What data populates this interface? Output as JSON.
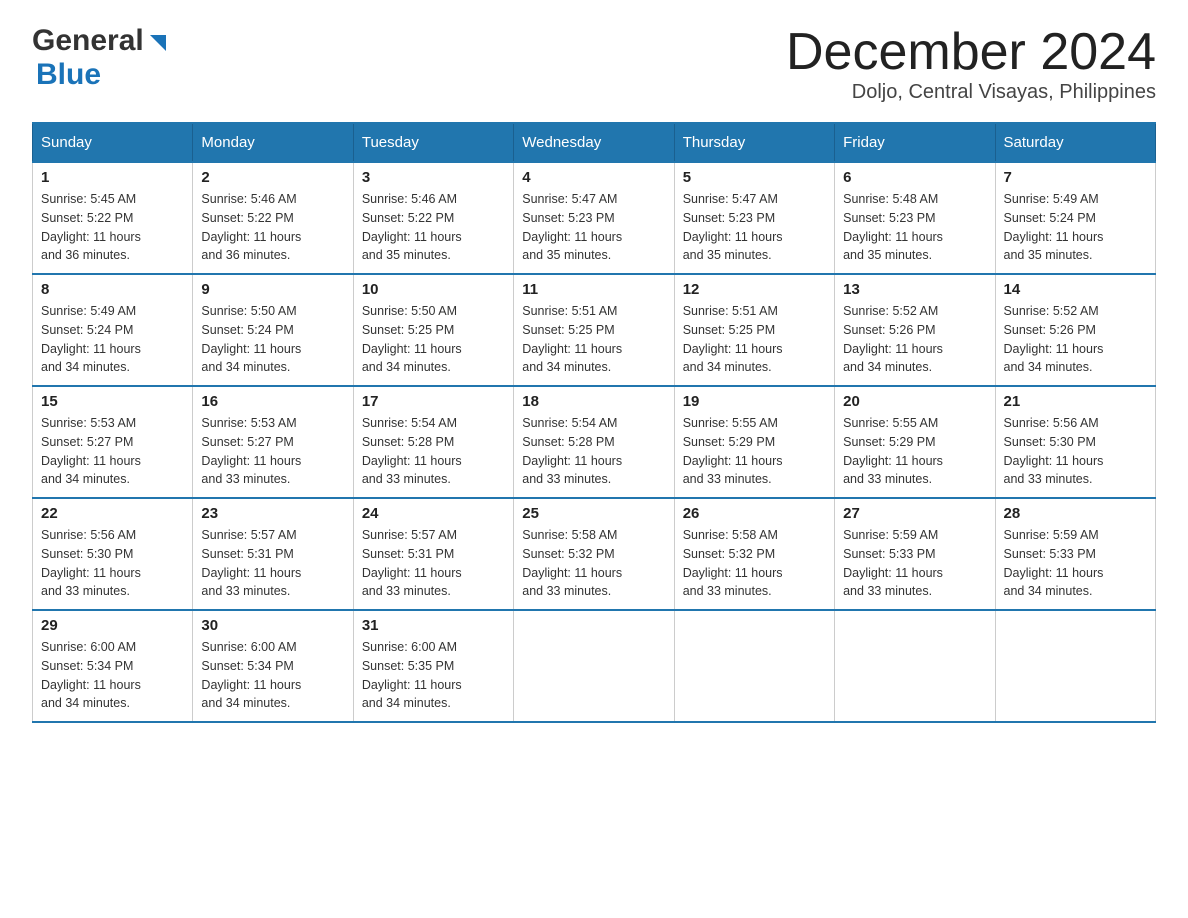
{
  "header": {
    "logo_general": "General",
    "logo_blue": "Blue",
    "month_title": "December 2024",
    "location": "Doljo, Central Visayas, Philippines"
  },
  "weekdays": [
    "Sunday",
    "Monday",
    "Tuesday",
    "Wednesday",
    "Thursday",
    "Friday",
    "Saturday"
  ],
  "weeks": [
    [
      {
        "day": "1",
        "sunrise": "5:45 AM",
        "sunset": "5:22 PM",
        "daylight": "11 hours and 36 minutes."
      },
      {
        "day": "2",
        "sunrise": "5:46 AM",
        "sunset": "5:22 PM",
        "daylight": "11 hours and 36 minutes."
      },
      {
        "day": "3",
        "sunrise": "5:46 AM",
        "sunset": "5:22 PM",
        "daylight": "11 hours and 35 minutes."
      },
      {
        "day": "4",
        "sunrise": "5:47 AM",
        "sunset": "5:23 PM",
        "daylight": "11 hours and 35 minutes."
      },
      {
        "day": "5",
        "sunrise": "5:47 AM",
        "sunset": "5:23 PM",
        "daylight": "11 hours and 35 minutes."
      },
      {
        "day": "6",
        "sunrise": "5:48 AM",
        "sunset": "5:23 PM",
        "daylight": "11 hours and 35 minutes."
      },
      {
        "day": "7",
        "sunrise": "5:49 AM",
        "sunset": "5:24 PM",
        "daylight": "11 hours and 35 minutes."
      }
    ],
    [
      {
        "day": "8",
        "sunrise": "5:49 AM",
        "sunset": "5:24 PM",
        "daylight": "11 hours and 34 minutes."
      },
      {
        "day": "9",
        "sunrise": "5:50 AM",
        "sunset": "5:24 PM",
        "daylight": "11 hours and 34 minutes."
      },
      {
        "day": "10",
        "sunrise": "5:50 AM",
        "sunset": "5:25 PM",
        "daylight": "11 hours and 34 minutes."
      },
      {
        "day": "11",
        "sunrise": "5:51 AM",
        "sunset": "5:25 PM",
        "daylight": "11 hours and 34 minutes."
      },
      {
        "day": "12",
        "sunrise": "5:51 AM",
        "sunset": "5:25 PM",
        "daylight": "11 hours and 34 minutes."
      },
      {
        "day": "13",
        "sunrise": "5:52 AM",
        "sunset": "5:26 PM",
        "daylight": "11 hours and 34 minutes."
      },
      {
        "day": "14",
        "sunrise": "5:52 AM",
        "sunset": "5:26 PM",
        "daylight": "11 hours and 34 minutes."
      }
    ],
    [
      {
        "day": "15",
        "sunrise": "5:53 AM",
        "sunset": "5:27 PM",
        "daylight": "11 hours and 34 minutes."
      },
      {
        "day": "16",
        "sunrise": "5:53 AM",
        "sunset": "5:27 PM",
        "daylight": "11 hours and 33 minutes."
      },
      {
        "day": "17",
        "sunrise": "5:54 AM",
        "sunset": "5:28 PM",
        "daylight": "11 hours and 33 minutes."
      },
      {
        "day": "18",
        "sunrise": "5:54 AM",
        "sunset": "5:28 PM",
        "daylight": "11 hours and 33 minutes."
      },
      {
        "day": "19",
        "sunrise": "5:55 AM",
        "sunset": "5:29 PM",
        "daylight": "11 hours and 33 minutes."
      },
      {
        "day": "20",
        "sunrise": "5:55 AM",
        "sunset": "5:29 PM",
        "daylight": "11 hours and 33 minutes."
      },
      {
        "day": "21",
        "sunrise": "5:56 AM",
        "sunset": "5:30 PM",
        "daylight": "11 hours and 33 minutes."
      }
    ],
    [
      {
        "day": "22",
        "sunrise": "5:56 AM",
        "sunset": "5:30 PM",
        "daylight": "11 hours and 33 minutes."
      },
      {
        "day": "23",
        "sunrise": "5:57 AM",
        "sunset": "5:31 PM",
        "daylight": "11 hours and 33 minutes."
      },
      {
        "day": "24",
        "sunrise": "5:57 AM",
        "sunset": "5:31 PM",
        "daylight": "11 hours and 33 minutes."
      },
      {
        "day": "25",
        "sunrise": "5:58 AM",
        "sunset": "5:32 PM",
        "daylight": "11 hours and 33 minutes."
      },
      {
        "day": "26",
        "sunrise": "5:58 AM",
        "sunset": "5:32 PM",
        "daylight": "11 hours and 33 minutes."
      },
      {
        "day": "27",
        "sunrise": "5:59 AM",
        "sunset": "5:33 PM",
        "daylight": "11 hours and 33 minutes."
      },
      {
        "day": "28",
        "sunrise": "5:59 AM",
        "sunset": "5:33 PM",
        "daylight": "11 hours and 34 minutes."
      }
    ],
    [
      {
        "day": "29",
        "sunrise": "6:00 AM",
        "sunset": "5:34 PM",
        "daylight": "11 hours and 34 minutes."
      },
      {
        "day": "30",
        "sunrise": "6:00 AM",
        "sunset": "5:34 PM",
        "daylight": "11 hours and 34 minutes."
      },
      {
        "day": "31",
        "sunrise": "6:00 AM",
        "sunset": "5:35 PM",
        "daylight": "11 hours and 34 minutes."
      },
      null,
      null,
      null,
      null
    ]
  ],
  "labels": {
    "sunrise": "Sunrise:",
    "sunset": "Sunset:",
    "daylight": "Daylight:"
  }
}
